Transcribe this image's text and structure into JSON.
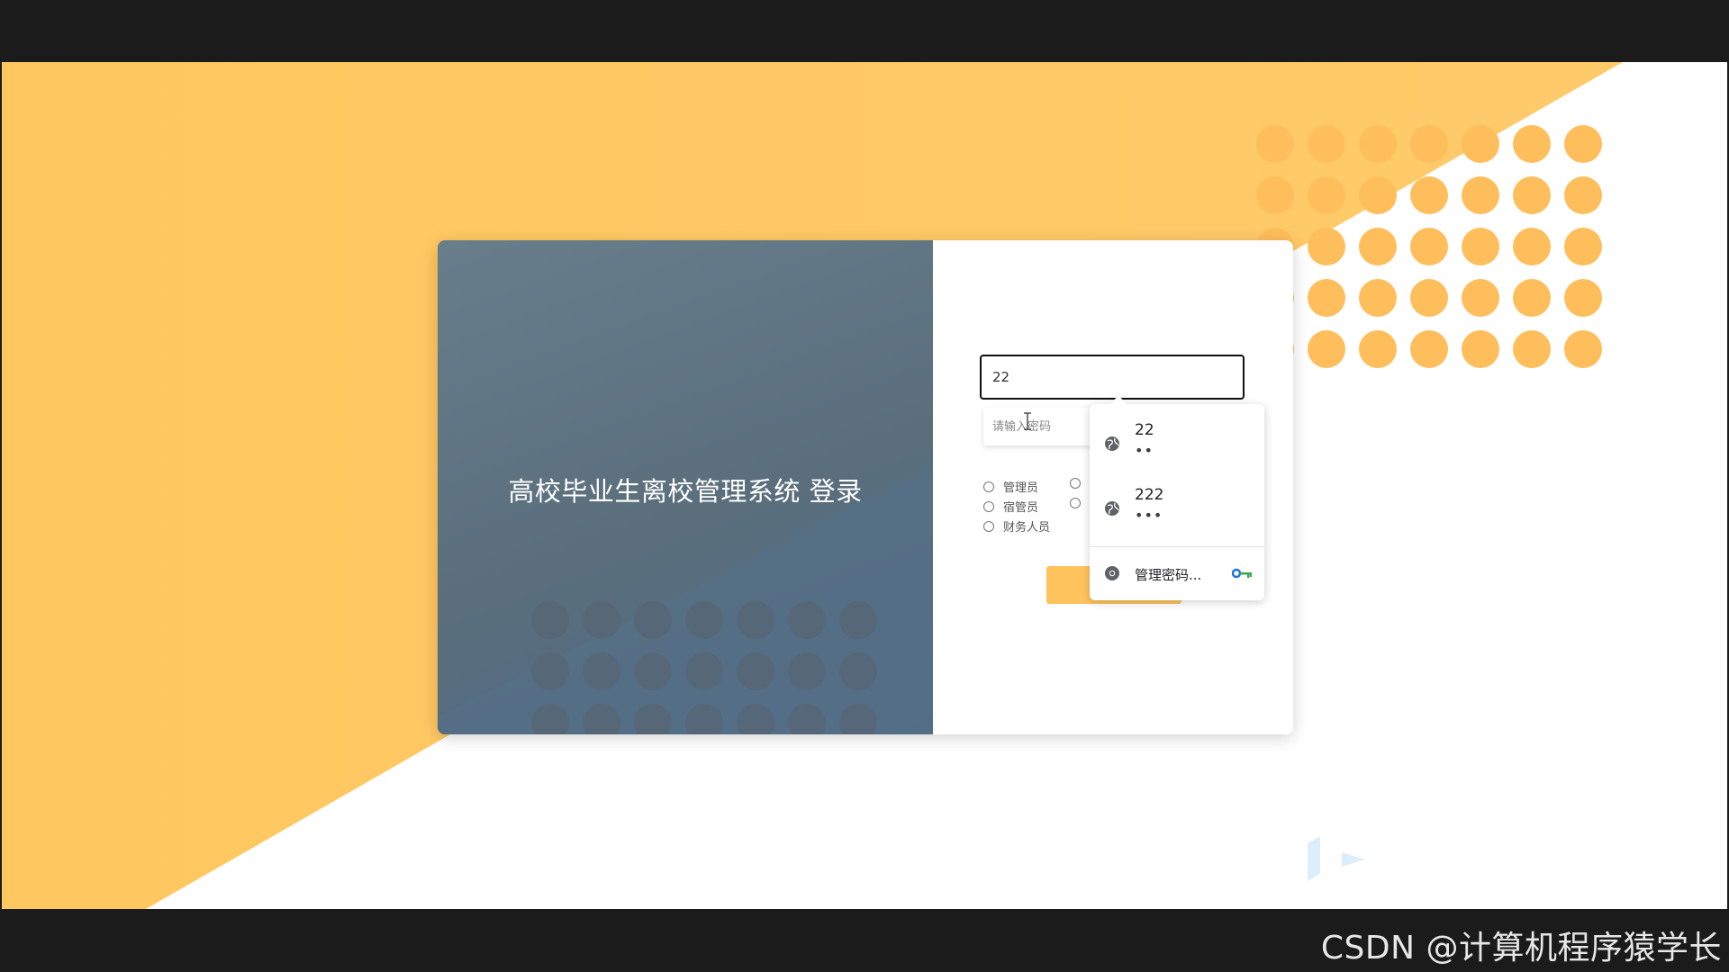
{
  "login": {
    "title": "高校毕业生离校管理系统 登录",
    "username_value": "22",
    "password_placeholder": "请输入密码",
    "roles": [
      "管理员",
      "宿管员",
      "财务人员"
    ],
    "login_button_label": ""
  },
  "autofill": {
    "suggestions": [
      {
        "username": "22",
        "masked_password": "••"
      },
      {
        "username": "222",
        "masked_password": "•••"
      }
    ],
    "manage_label": "管理密码..."
  },
  "watermark": {
    "text": "CSDN @计算机程序猿学长"
  },
  "colors": {
    "accent_orange": "#ffc35e",
    "dot_orange": "#ffbe5c",
    "card_left_bg": "#5f7483",
    "page_bg": "#1b1b1b"
  }
}
